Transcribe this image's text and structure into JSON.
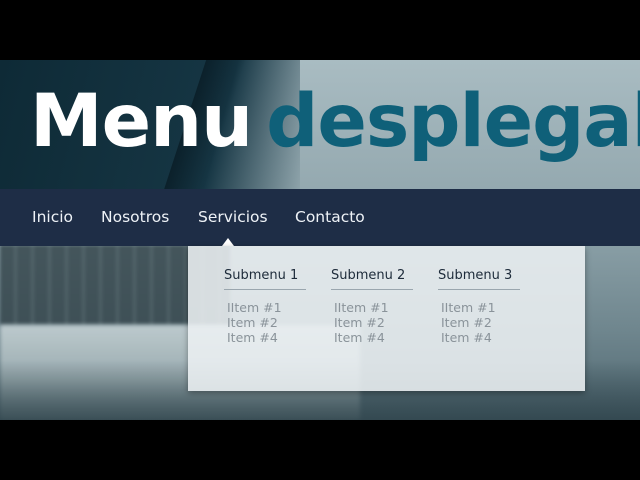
{
  "title": {
    "word1": "Menu",
    "word2": "desplegable"
  },
  "nav": {
    "items": [
      {
        "label": "Inicio"
      },
      {
        "label": "Nosotros"
      },
      {
        "label": "Servicios"
      },
      {
        "label": "Contacto"
      }
    ]
  },
  "dropdown": {
    "submenus": [
      {
        "title": "Submenu 1",
        "items": [
          "IItem #1",
          "Item #2",
          "Item #4"
        ]
      },
      {
        "title": "Submenu 2",
        "items": [
          "IItem #1",
          "Item #2",
          "Item #4"
        ]
      },
      {
        "title": "Submenu 3",
        "items": [
          "IItem #1",
          "Item #2",
          "Item #4"
        ]
      }
    ]
  },
  "colors": {
    "navbar": "#1e2d46",
    "title_accent": "#0f6079",
    "title_main": "#ffffff"
  }
}
